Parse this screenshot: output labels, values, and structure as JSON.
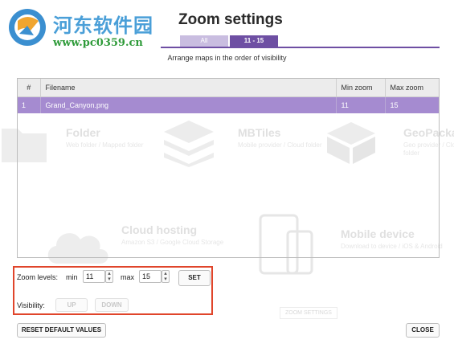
{
  "watermark": {
    "title": "河东软件园",
    "url": "www.pc0359.cn"
  },
  "dialog": {
    "title": "Zoom settings",
    "tabs": [
      {
        "label": "All",
        "active": false
      },
      {
        "label": "11 - 15",
        "active": true
      }
    ],
    "subtitle": "Arrange maps in the order of visibility"
  },
  "table": {
    "headers": [
      "#",
      "Filename",
      "Min zoom",
      "Max zoom"
    ],
    "rows": [
      {
        "index": "1",
        "filename": "Grand_Canyon.png",
        "min": "11",
        "max": "15",
        "selected": true
      }
    ]
  },
  "zoom_levels": {
    "label": "Zoom levels:",
    "min_label": "min",
    "min_value": "11",
    "max_label": "max",
    "max_value": "15",
    "set_label": "SET"
  },
  "visibility": {
    "label": "Visibility:",
    "up_label": "UP",
    "down_label": "DOWN"
  },
  "footer": {
    "reset_label": "RESET DEFAULT VALUES",
    "close_label": "CLOSE"
  },
  "background": {
    "cards": [
      {
        "title": "Folder",
        "sub": "Web folder / Mapped folder"
      },
      {
        "title": "MBTiles",
        "sub": "Mobile provider / Cloud folder"
      },
      {
        "title": "GeoPackage",
        "sub": "Geo provider / Cloud folder"
      },
      {
        "title": "Cloud hosting",
        "sub": "Amazon S3 / Google Cloud Storage"
      },
      {
        "title": "Mobile device",
        "sub": "Download to device / iOS & Android"
      }
    ],
    "zoom_settings_ghost": "ZOOM SETTINGS"
  },
  "colors": {
    "accent": "#6e4fa3",
    "selected_row": "#a58bd0",
    "highlight": "#e0452b"
  }
}
